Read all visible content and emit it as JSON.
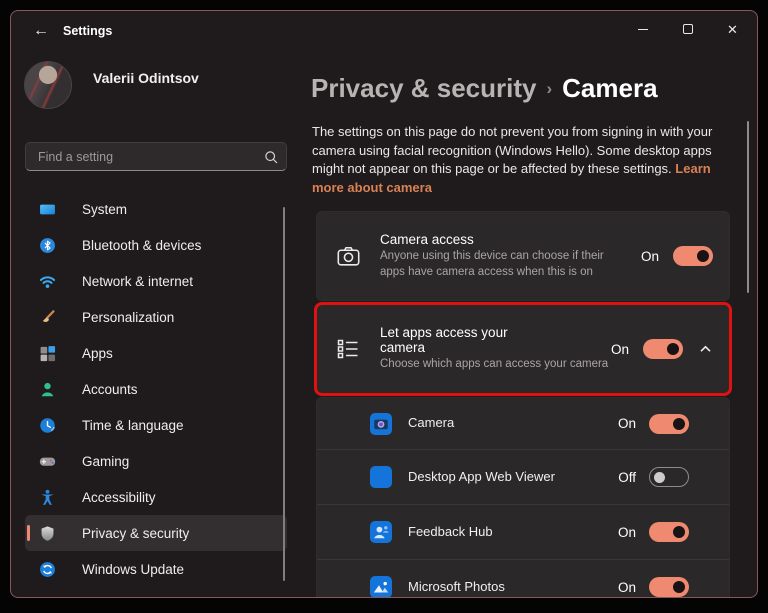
{
  "window": {
    "title": "Settings",
    "controls": {
      "minimize": "minimize",
      "maximize": "maximize",
      "close": "close"
    }
  },
  "sidebar": {
    "user": {
      "name": "Valerii Odintsov"
    },
    "search": {
      "placeholder": "Find a setting",
      "icon": "search-icon"
    },
    "items": [
      {
        "label": "System",
        "icon": "system-icon"
      },
      {
        "label": "Bluetooth & devices",
        "icon": "bluetooth-icon"
      },
      {
        "label": "Network & internet",
        "icon": "network-icon"
      },
      {
        "label": "Personalization",
        "icon": "personalization-icon"
      },
      {
        "label": "Apps",
        "icon": "apps-icon"
      },
      {
        "label": "Accounts",
        "icon": "accounts-icon"
      },
      {
        "label": "Time & language",
        "icon": "time-language-icon"
      },
      {
        "label": "Gaming",
        "icon": "gaming-icon"
      },
      {
        "label": "Accessibility",
        "icon": "accessibility-icon"
      },
      {
        "label": "Privacy & security",
        "icon": "shield-icon",
        "selected": true
      },
      {
        "label": "Windows Update",
        "icon": "windows-update-icon"
      }
    ]
  },
  "main": {
    "breadcrumb": {
      "parent": "Privacy & security",
      "separator": "›",
      "current": "Camera"
    },
    "description": {
      "text": "The settings on this page do not prevent you from signing in with your camera using facial recognition (Windows Hello). Some desktop apps might not appear on this page or be affected by these settings.",
      "link": "Learn more about camera"
    },
    "cards": [
      {
        "title": "Camera access",
        "description": "Anyone using this device can choose if their apps have camera access when this is on",
        "state": "On",
        "icon": "camera-outline-icon"
      },
      {
        "title": "Let apps access your camera",
        "description": "Choose which apps can access your camera",
        "state": "On",
        "icon": "app-list-icon",
        "expanded": true,
        "highlighted": true
      }
    ],
    "apps": [
      {
        "name": "Camera",
        "state": "On",
        "icon": "camera-app-icon"
      },
      {
        "name": "Desktop App Web Viewer",
        "state": "Off",
        "icon": "desktop-app-web-viewer-icon"
      },
      {
        "name": "Feedback Hub",
        "state": "On",
        "icon": "feedback-hub-icon"
      },
      {
        "name": "Microsoft Photos",
        "state": "On",
        "icon": "microsoft-photos-icon"
      }
    ]
  },
  "colors": {
    "accent_toggle": "#ef8a70",
    "link": "#d98155",
    "highlight_border": "#df1111",
    "window_bg": "#1f1b1c",
    "card_bg": "#2b2829"
  }
}
